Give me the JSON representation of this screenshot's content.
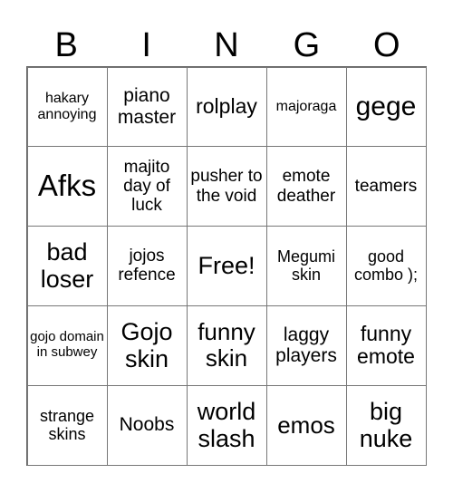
{
  "header": {
    "letters": [
      "B",
      "I",
      "N",
      "G",
      "O"
    ]
  },
  "board": {
    "rows": [
      [
        "hakary annoying",
        "piano master",
        "rolplay",
        "majoraga",
        "gege"
      ],
      [
        "Afks",
        "majito day of luck",
        "pusher to the void",
        "emote deather",
        "teamers"
      ],
      [
        "bad loser",
        "jojos refence",
        "Free!",
        "Megumi skin",
        "good combo );"
      ],
      [
        "gojo domain in subwey",
        "Gojo skin",
        "funny skin",
        "laggy players",
        "funny emote"
      ],
      [
        "strange skins",
        "Noobs",
        "world slash",
        "emos",
        "big nuke"
      ]
    ]
  }
}
